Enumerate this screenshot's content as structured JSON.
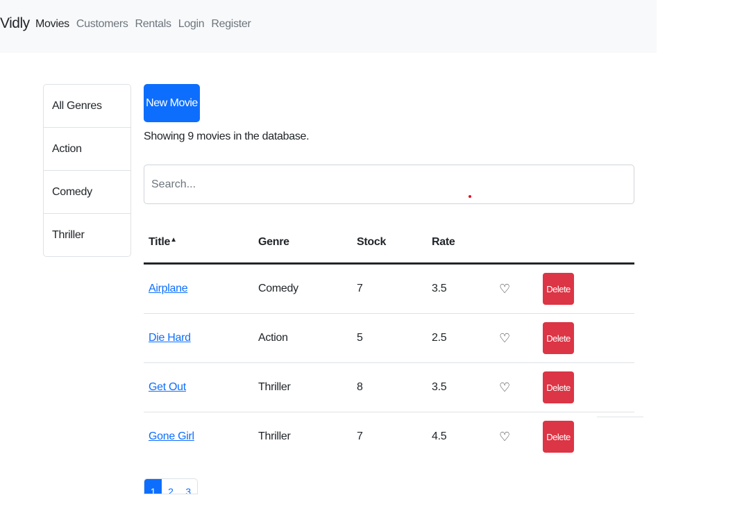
{
  "navbar": {
    "brand": "Vidly",
    "links": [
      "Movies",
      "Customers",
      "Rentals",
      "Login",
      "Register"
    ]
  },
  "genres": [
    "All Genres",
    "Action",
    "Comedy",
    "Thriller"
  ],
  "new_movie_label": "New Movie",
  "count_text": "Showing 9 movies in the database.",
  "search": {
    "placeholder": "Search...",
    "value": ""
  },
  "table": {
    "headers": {
      "title": "Title",
      "sort_icon": "▲",
      "genre": "Genre",
      "stock": "Stock",
      "rate": "Rate"
    },
    "rows": [
      {
        "title": "Airplane",
        "genre": "Comedy",
        "stock": "7",
        "rate": "3.5",
        "like_icon": "heart-outline-icon",
        "delete": "Delete"
      },
      {
        "title": "Die Hard",
        "genre": "Action",
        "stock": "5",
        "rate": "2.5",
        "like_icon": "heart-outline-icon",
        "delete": "Delete"
      },
      {
        "title": "Get Out",
        "genre": "Thriller",
        "stock": "8",
        "rate": "3.5",
        "like_icon": "heart-outline-icon",
        "delete": "Delete"
      },
      {
        "title": "Gone Girl",
        "genre": "Thriller",
        "stock": "7",
        "rate": "4.5",
        "like_icon": "heart-outline-icon",
        "delete": "Delete"
      }
    ]
  },
  "pagination": {
    "pages": [
      "1",
      "2",
      "3"
    ],
    "current": "1"
  },
  "colors": {
    "primary": "#0d6efd",
    "danger": "#dc3545",
    "navbar_bg": "#f8f9fa"
  }
}
